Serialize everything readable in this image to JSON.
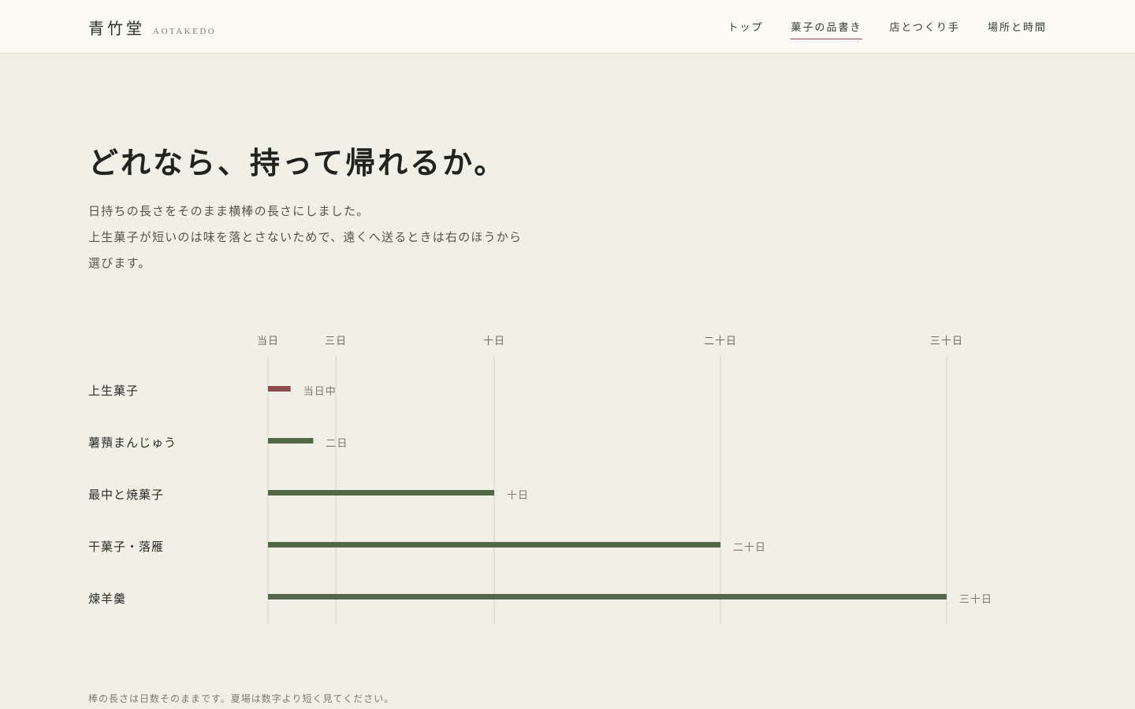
{
  "header": {
    "brand_jp": "青竹堂",
    "brand_en": "AOTAKEDO",
    "nav": [
      {
        "label": "トップ",
        "active": false
      },
      {
        "label": "菓子の品書き",
        "active": true
      },
      {
        "label": "店とつくり手",
        "active": false
      },
      {
        "label": "場所と時間",
        "active": false
      }
    ]
  },
  "hero": {
    "title": "どれなら、持って帰れるか。",
    "intro_lines": [
      "日持ちの長さをそのまま横棒の長さにしました。",
      "上生菓子が短いのは味を落とさないためで、遠くへ送るときは右のほうから",
      "選びます。"
    ]
  },
  "colors": {
    "accent": "#8f4d4a",
    "bar": "#526846",
    "grid": "#d6d4c7",
    "background": "#f1f0e6"
  },
  "chart_data": {
    "type": "bar",
    "orientation": "horizontal",
    "x_ticks": [
      {
        "value": 0,
        "label": "当日"
      },
      {
        "value": 3,
        "label": "三日"
      },
      {
        "value": 10,
        "label": "十日"
      },
      {
        "value": 20,
        "label": "二十日"
      },
      {
        "value": 30,
        "label": "三十日"
      }
    ],
    "xlim": [
      0,
      30
    ],
    "categories": [
      "上生菓子",
      "薯蕷まんじゅう",
      "最中と焼菓子",
      "干菓子・落雁",
      "煉羊羹"
    ],
    "values": [
      1,
      2,
      10,
      20,
      30
    ],
    "value_labels": [
      "当日中",
      "二日",
      "十日",
      "二十日",
      "三十日"
    ],
    "highlight_index": 0,
    "grid": true,
    "title": "",
    "xlabel": "",
    "ylabel": ""
  },
  "footnote": "棒の長さは日数そのままです。夏場は数字より短く見てください。"
}
